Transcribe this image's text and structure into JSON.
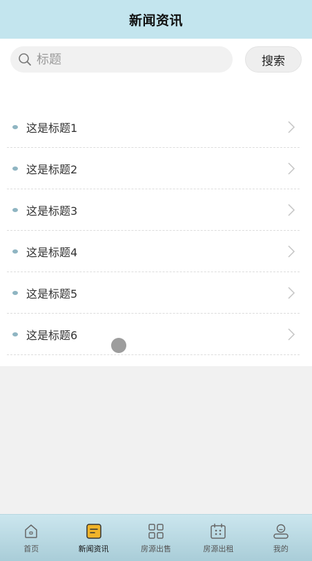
{
  "header": {
    "title": "新闻资讯"
  },
  "search": {
    "placeholder": "标题",
    "value": "",
    "button_label": "搜索"
  },
  "news": {
    "items": [
      {
        "title": "这是标题1"
      },
      {
        "title": "这是标题2"
      },
      {
        "title": "这是标题3"
      },
      {
        "title": "这是标题4"
      },
      {
        "title": "这是标题5"
      },
      {
        "title": "这是标题6"
      }
    ]
  },
  "tabbar": {
    "active_index": 1,
    "tabs": [
      {
        "label": "首页",
        "icon": "home-icon"
      },
      {
        "label": "新闻资讯",
        "icon": "news-icon"
      },
      {
        "label": "房源出售",
        "icon": "grid-icon"
      },
      {
        "label": "房源出租",
        "icon": "calendar-icon"
      },
      {
        "label": "我的",
        "icon": "user-icon"
      }
    ]
  },
  "colors": {
    "header_bg": "#c3e5ee",
    "accent": "#f0b429",
    "tabbar_bg": "#a9cdd8"
  }
}
